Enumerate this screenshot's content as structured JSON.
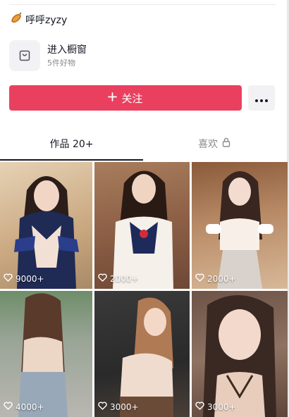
{
  "profile": {
    "username": "呼呼zyzy"
  },
  "shop": {
    "title": "进入橱窗",
    "subtitle": "5件好物"
  },
  "actions": {
    "follow_label": "关注"
  },
  "tabs": [
    {
      "label": "作品 20+"
    },
    {
      "label": "喜欢"
    }
  ],
  "posts": [
    {
      "likes": "9000+"
    },
    {
      "likes": "2000+"
    },
    {
      "likes": "2000+"
    },
    {
      "likes": "4000+"
    },
    {
      "likes": "3000+"
    },
    {
      "likes": "3000+"
    }
  ],
  "colors": {
    "accent": "#ea4060"
  },
  "icons": [
    "sweet-potato-icon",
    "shop-bag-icon",
    "plus-icon",
    "more-dots-icon",
    "lock-icon",
    "heart-icon"
  ]
}
